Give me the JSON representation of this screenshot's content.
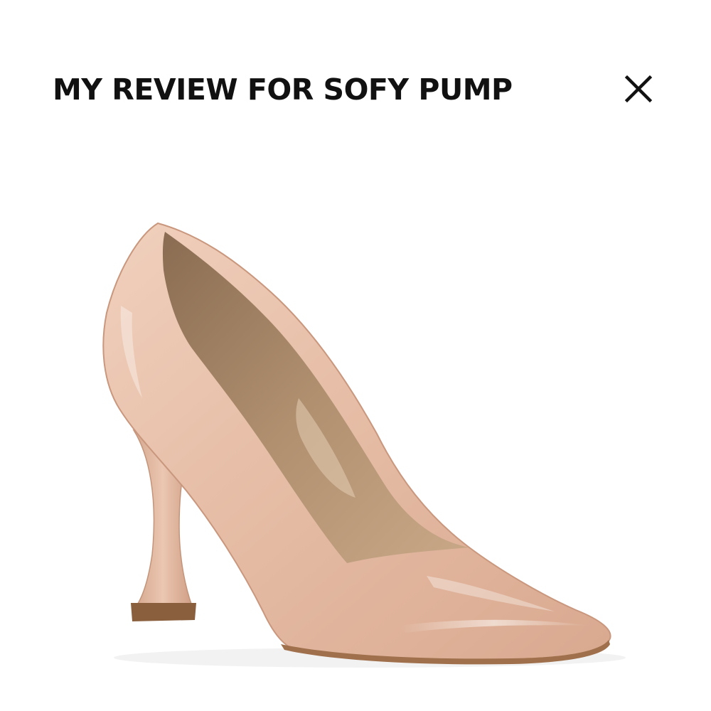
{
  "modal": {
    "title": "MY REVIEW FOR SOFY PUMP",
    "close_icon": "close-icon"
  },
  "product": {
    "image_subject": "nude patent pointed-toe pump with flared heel",
    "colors": {
      "patent": "#e3b9a2",
      "lining": "#a8886a",
      "sole": "#b98a66"
    }
  }
}
